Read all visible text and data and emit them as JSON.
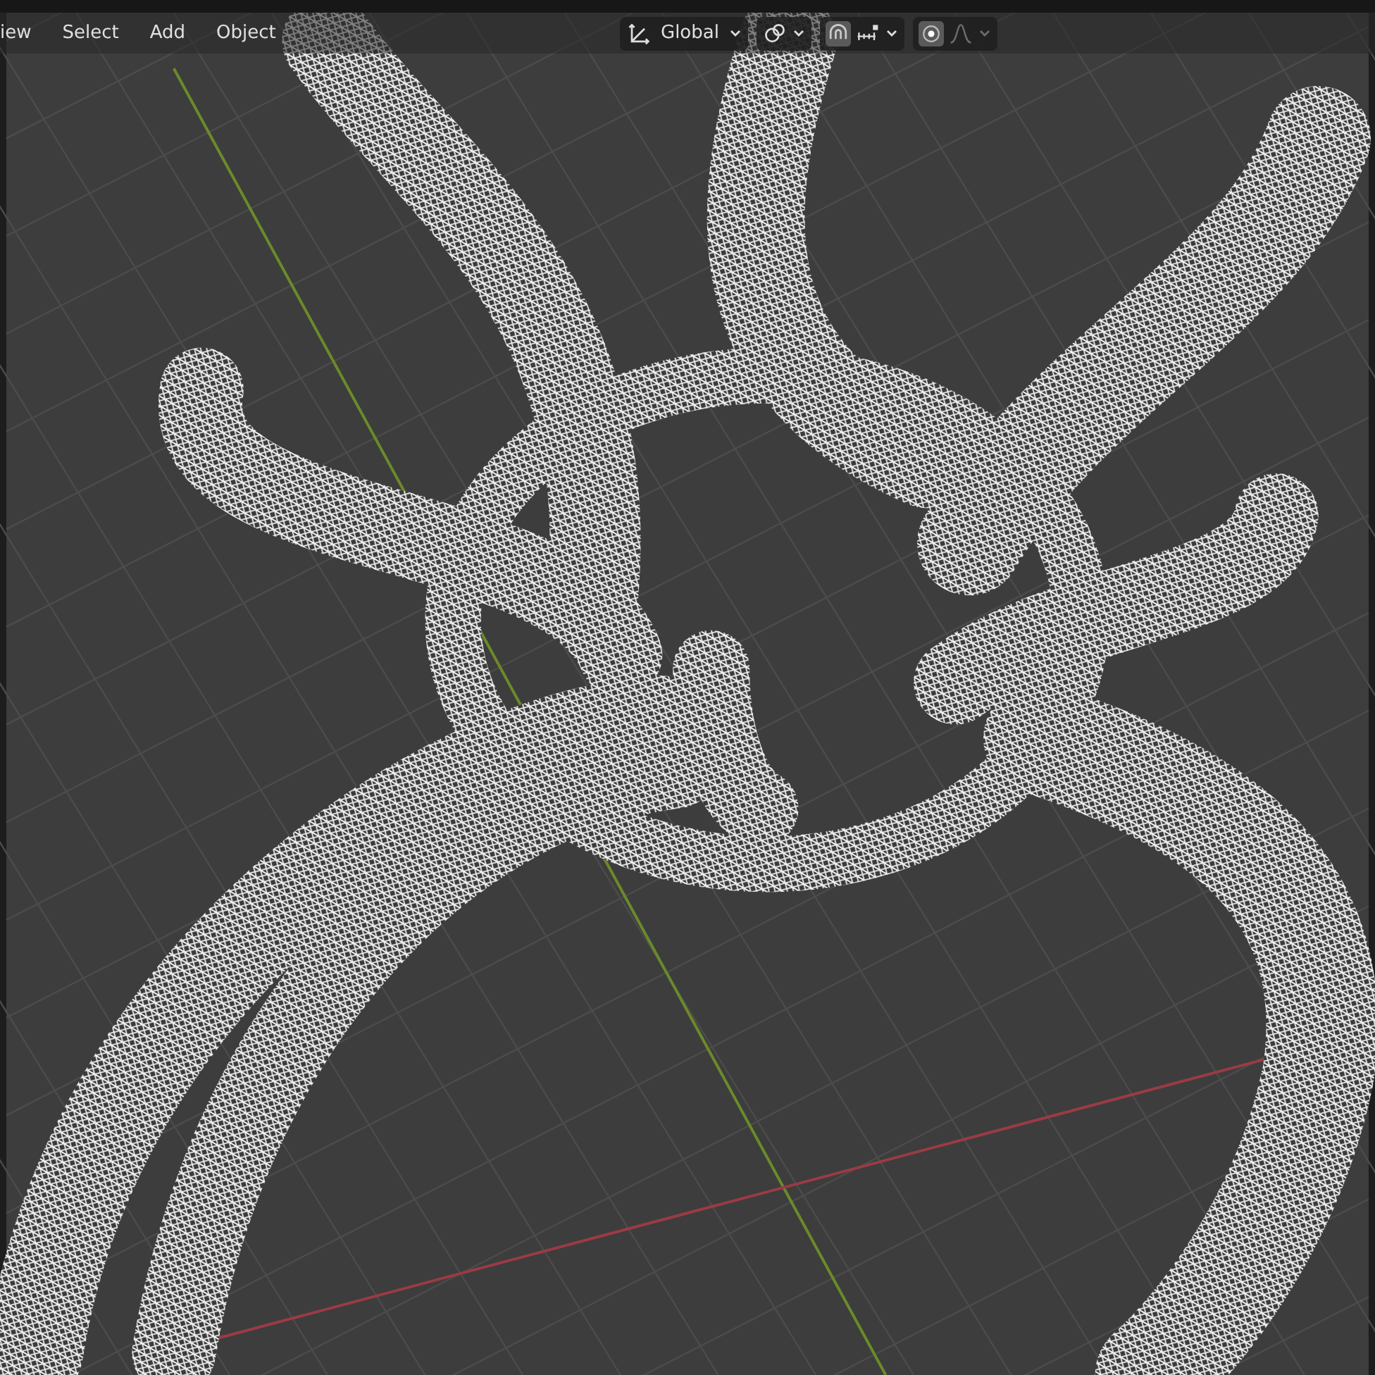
{
  "header": {
    "menus": [
      {
        "label": "iew"
      },
      {
        "label": "Select"
      },
      {
        "label": "Add"
      },
      {
        "label": "Object"
      }
    ],
    "orientation": {
      "label": "Global"
    },
    "snapping": {
      "on": true
    },
    "proportional_editing": {
      "on": true
    },
    "falloff": {
      "disabled": true
    }
  }
}
